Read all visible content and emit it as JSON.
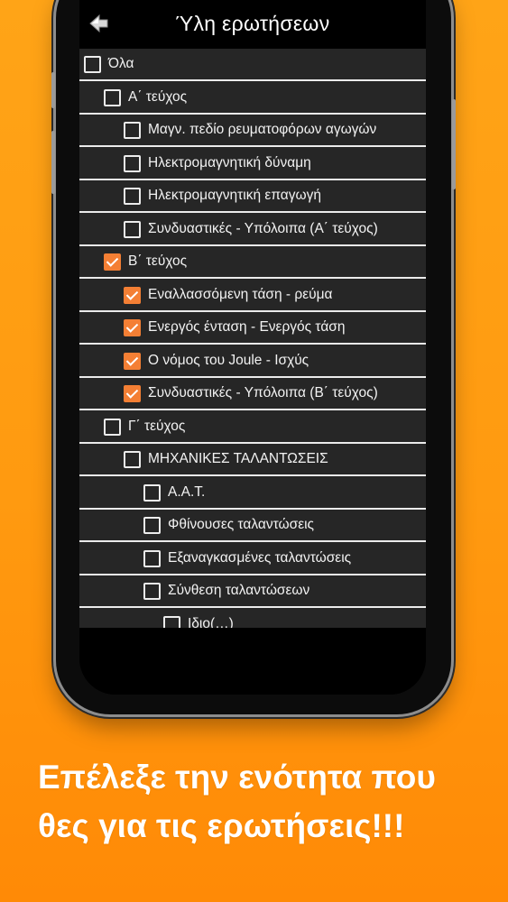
{
  "screen": {
    "title": "Ύλη ερωτήσεων",
    "back_icon": "back-arrow-icon"
  },
  "items": [
    {
      "label": "Όλα",
      "checked": false,
      "level": 0
    },
    {
      "label": "Α΄ τεύχος",
      "checked": false,
      "level": 1
    },
    {
      "label": "Μαγν. πεδίο ρευματοφόρων αγωγών",
      "checked": false,
      "level": 2
    },
    {
      "label": "Ηλεκτρομαγνητική δύναμη",
      "checked": false,
      "level": 2
    },
    {
      "label": "Ηλεκτρομαγνητική επαγωγή",
      "checked": false,
      "level": 2
    },
    {
      "label": "Συνδυαστικές - Υπόλοιπα (Α΄ τεύχος)",
      "checked": false,
      "level": 2
    },
    {
      "label": "Β΄ τεύχος",
      "checked": true,
      "level": 1
    },
    {
      "label": "Εναλλασσόμενη τάση - ρεύμα",
      "checked": true,
      "level": 2
    },
    {
      "label": "Ενεργός ένταση - Ενεργός τάση",
      "checked": true,
      "level": 2
    },
    {
      "label": "Ο νόμος του Joule - Ισχύς",
      "checked": true,
      "level": 2
    },
    {
      "label": "Συνδυαστικές - Υπόλοιπα (Β΄ τεύχος)",
      "checked": true,
      "level": 2
    },
    {
      "label": "Γ΄ τεύχος",
      "checked": false,
      "level": 1
    },
    {
      "label": "ΜΗΧΑΝΙΚΕΣ ΤΑΛΑΝΤΩΣΕΙΣ",
      "checked": false,
      "level": 2
    },
    {
      "label": "Α.Α.Τ.",
      "checked": false,
      "level": 3
    },
    {
      "label": "Φθίνουσες ταλαντώσεις",
      "checked": false,
      "level": 3
    },
    {
      "label": "Εξαναγκασμένες ταλαντώσεις",
      "checked": false,
      "level": 3
    },
    {
      "label": "Σύνθεση ταλαντώσεων",
      "checked": false,
      "level": 3
    },
    {
      "label": "Ιδιο(…)",
      "checked": false,
      "level": 4
    }
  ],
  "caption": {
    "line1": "Επέλεξε την ενότητα που",
    "line2": "θες για τις ερωτήσεις!!!"
  },
  "colors": {
    "accent": "#f47f34",
    "background_top": "#ffa417",
    "background_bottom": "#ff8a06",
    "list_bg": "#262626"
  }
}
